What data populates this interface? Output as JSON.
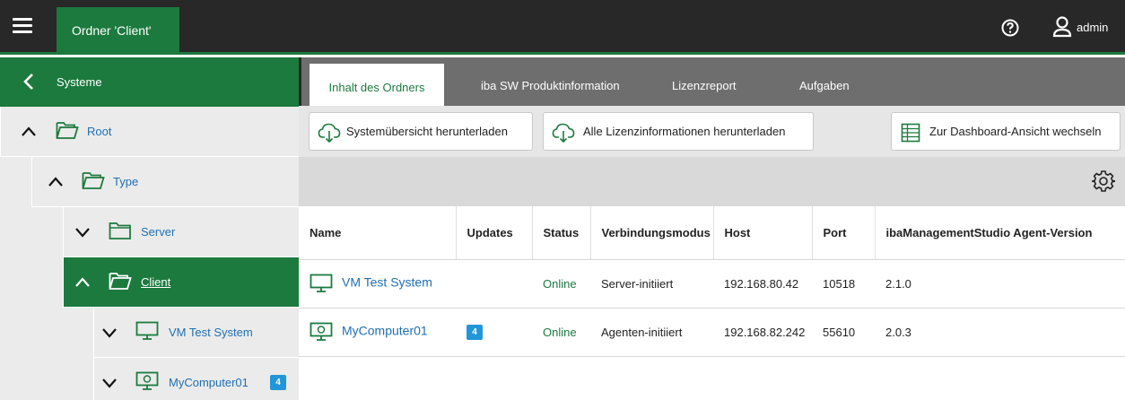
{
  "header": {
    "folder_tab": "Ordner 'Client'",
    "user_name": "admin"
  },
  "sidebar": {
    "back_label": "Systeme",
    "tree": [
      {
        "label": "Root",
        "expanded": true
      },
      {
        "label": "Type",
        "expanded": true
      },
      {
        "label": "Server",
        "expanded": false
      },
      {
        "label": "Client",
        "expanded": true,
        "active": true
      },
      {
        "label": "VM Test System",
        "expanded": false
      },
      {
        "label": "MyComputer01",
        "expanded": false,
        "badge": "4"
      }
    ]
  },
  "tabs": [
    "Inhalt des Ordners",
    "iba SW Produktinformation",
    "Lizenzreport",
    "Aufgaben"
  ],
  "toolbar": {
    "download_overview": "Systemübersicht herunterladen",
    "download_licenses": "Alle Lizenzinformationen herunterladen",
    "dashboard_view": "Zur Dashboard-Ansicht wechseln"
  },
  "table": {
    "headers": [
      "Name",
      "Updates",
      "Status",
      "Verbindungsmodus",
      "Host",
      "Port",
      "ibaManagementStudio Agent-Version"
    ],
    "rows": [
      {
        "name": "VM Test System",
        "updates": "",
        "status": "Online",
        "mode": "Server-initiiert",
        "host": "192.168.80.42",
        "port": "10518",
        "version": "2.1.0"
      },
      {
        "name": "MyComputer01",
        "updates": "4",
        "status": "Online",
        "mode": "Agenten-initiiert",
        "host": "192.168.82.242",
        "port": "55610",
        "version": "2.0.3"
      }
    ]
  },
  "colors": {
    "brand_green": "#1c7a3e",
    "topbar": "#282828",
    "link_blue": "#1f6fb5",
    "badge_blue": "#2196d8"
  }
}
